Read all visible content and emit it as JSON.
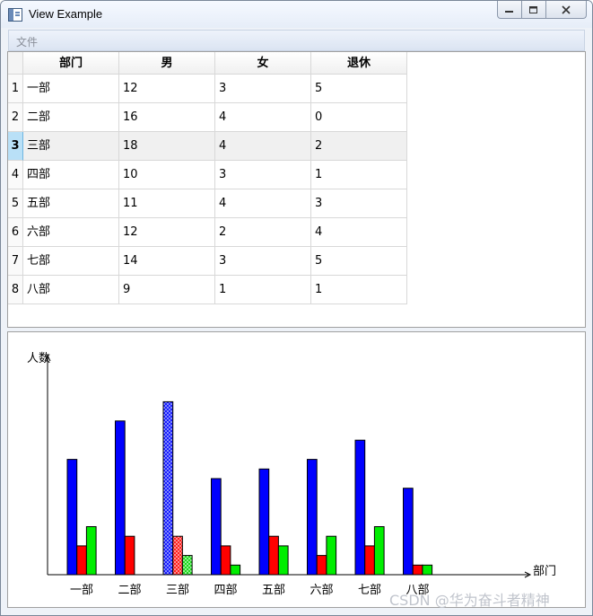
{
  "window": {
    "title": "View Example",
    "controls": {
      "minimize_icon": "minimize-icon",
      "maximize_icon": "maximize-icon",
      "close_icon": "close-icon"
    }
  },
  "menu": {
    "items": [
      "文件"
    ]
  },
  "table": {
    "headers": [
      "部门",
      "男",
      "女",
      "退休"
    ],
    "row_numbers": [
      "1",
      "2",
      "3",
      "4",
      "5",
      "6",
      "7",
      "8"
    ],
    "selected_row": 3,
    "rows": [
      [
        "一部",
        "12",
        "3",
        "5"
      ],
      [
        "二部",
        "16",
        "4",
        "0"
      ],
      [
        "三部",
        "18",
        "4",
        "2"
      ],
      [
        "四部",
        "10",
        "3",
        "1"
      ],
      [
        "五部",
        "11",
        "4",
        "3"
      ],
      [
        "六部",
        "12",
        "2",
        "4"
      ],
      [
        "七部",
        "14",
        "3",
        "5"
      ],
      [
        "八部",
        "9",
        "1",
        "1"
      ]
    ]
  },
  "chart_data": {
    "type": "bar",
    "ylabel": "人数",
    "xlabel": "部门",
    "categories": [
      "一部",
      "二部",
      "三部",
      "四部",
      "五部",
      "六部",
      "七部",
      "八部"
    ],
    "series": [
      {
        "values": [
          12,
          16,
          18,
          10,
          11,
          12,
          14,
          9
        ],
        "color": "#0000ff"
      },
      {
        "values": [
          3,
          4,
          4,
          3,
          4,
          2,
          3,
          1
        ],
        "color": "#ff0000"
      },
      {
        "values": [
          5,
          0,
          2,
          1,
          3,
          4,
          5,
          1
        ],
        "color": "#00ee00"
      }
    ],
    "highlighted_category": "三部",
    "grid": false,
    "legend": "none"
  },
  "watermark": "CSDN @华为奋斗者精神"
}
